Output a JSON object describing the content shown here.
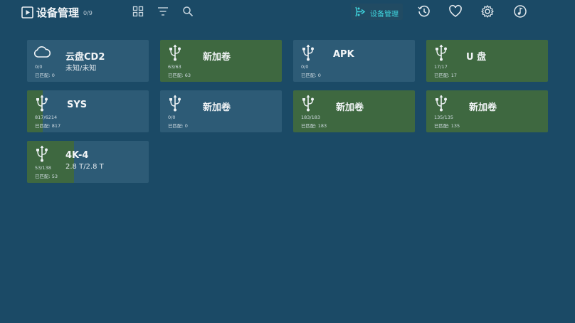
{
  "header": {
    "title": "设备管理",
    "count": "0/9",
    "tools": [
      "grid-icon",
      "filter-icon",
      "search-icon"
    ],
    "nav_active_label": "设备管理",
    "nav_icons": [
      "history-icon",
      "heart-icon",
      "gear-icon",
      "music-icon"
    ]
  },
  "colors": {
    "background": "#1b4a66",
    "card": "#2d5b76",
    "progress_fill": "#3e6840",
    "accent": "#3fd3dc"
  },
  "devices": [
    {
      "icon": "cloud-icon",
      "name": "云盘CD2",
      "subtitle": "未知/未知",
      "count": "0/0",
      "match": "已匹配: 0",
      "progress": 0
    },
    {
      "icon": "usb-icon",
      "name": "新加卷",
      "subtitle": "",
      "count": "63/63",
      "match": "已匹配: 63",
      "progress": 1
    },
    {
      "icon": "usb-icon",
      "name": "APK",
      "subtitle": "",
      "count": "0/0",
      "match": "已匹配: 0",
      "progress": 0
    },
    {
      "icon": "usb-icon",
      "name": "U 盘",
      "subtitle": "",
      "count": "17/17",
      "match": "已匹配: 17",
      "progress": 1
    },
    {
      "icon": "usb-icon",
      "name": "SYS",
      "subtitle": "",
      "count": "817/6214",
      "match": "已匹配: 817",
      "progress": 0.13
    },
    {
      "icon": "usb-icon",
      "name": "新加卷",
      "subtitle": "",
      "count": "0/0",
      "match": "已匹配: 0",
      "progress": 0
    },
    {
      "icon": "usb-icon",
      "name": "新加卷",
      "subtitle": "",
      "count": "183/183",
      "match": "已匹配: 183",
      "progress": 1
    },
    {
      "icon": "usb-icon",
      "name": "新加卷",
      "subtitle": "",
      "count": "135/135",
      "match": "已匹配: 135",
      "progress": 1
    },
    {
      "icon": "usb-icon",
      "name": "4K-4",
      "subtitle": "2.8 T/2.8 T",
      "count": "53/138",
      "match": "已匹配: 53",
      "progress": 0.384
    }
  ]
}
